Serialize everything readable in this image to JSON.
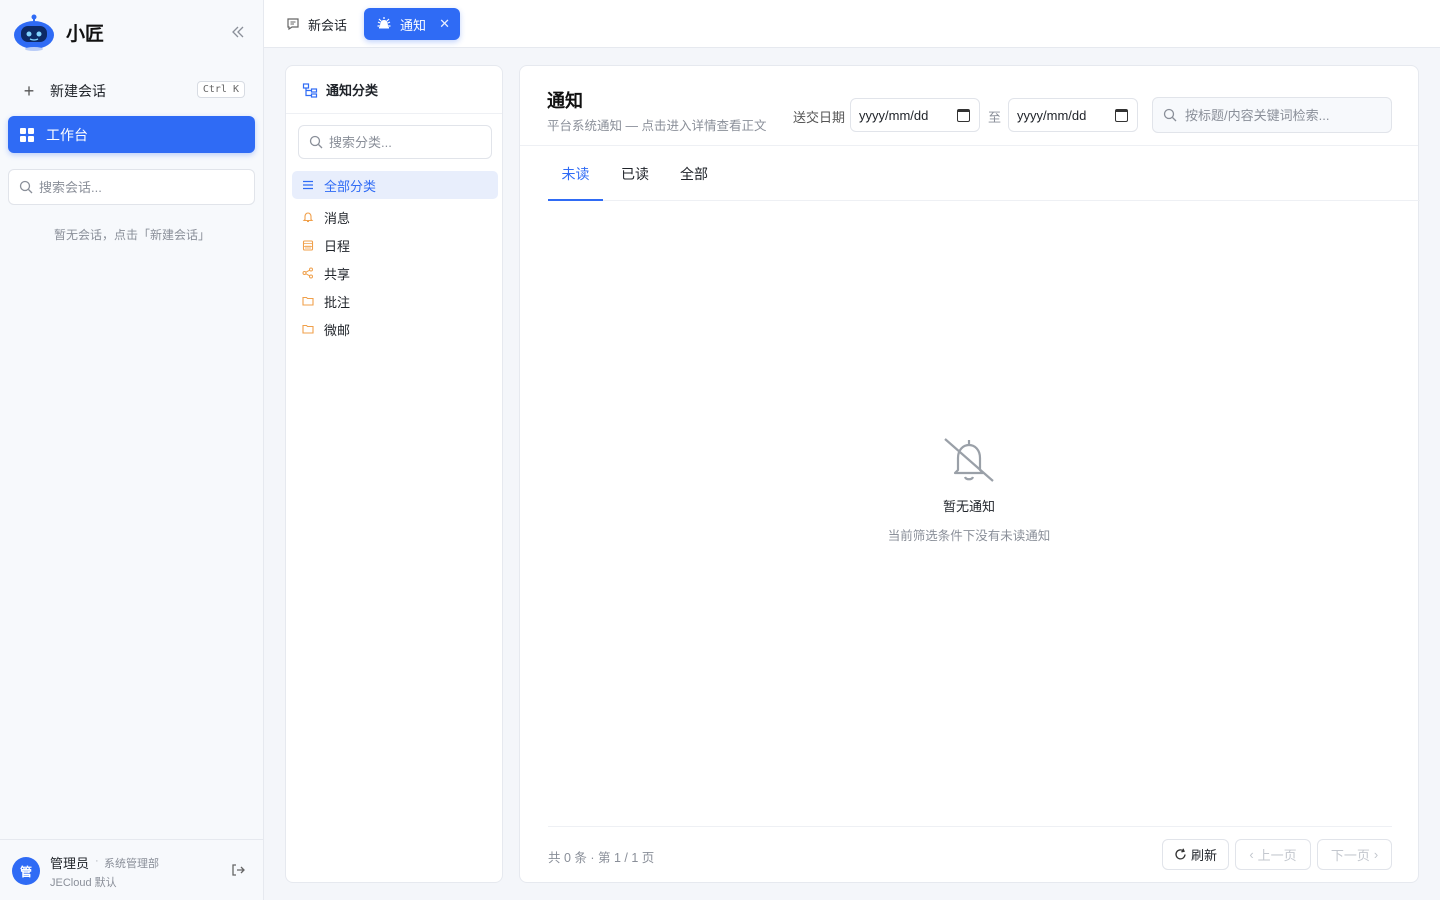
{
  "app": {
    "name": "小匠"
  },
  "sidebar": {
    "new_chat_label": "新建会话",
    "shortcut": "Ctrl K",
    "workbench_label": "工作台",
    "search_placeholder": "搜索会话...",
    "empty_text": "暂无会话，点击「新建会话」"
  },
  "user": {
    "avatar_text": "管",
    "name": "管理员",
    "separator": "·",
    "role": "系统管理部",
    "org": "JECloud 默认"
  },
  "tabs": [
    {
      "label": "新会话",
      "active": false
    },
    {
      "label": "通知",
      "active": true
    }
  ],
  "categories": {
    "title": "通知分类",
    "search_placeholder": "搜索分类...",
    "items": [
      {
        "label": "全部分类",
        "icon": "list-icon",
        "active": true
      },
      {
        "label": "消息",
        "icon": "bell-icon",
        "active": false
      },
      {
        "label": "日程",
        "icon": "calendar-icon",
        "active": false
      },
      {
        "label": "共享",
        "icon": "share-icon",
        "active": false
      },
      {
        "label": "批注",
        "icon": "folder-icon",
        "active": false
      },
      {
        "label": "微邮",
        "icon": "folder-icon",
        "active": false
      }
    ]
  },
  "main": {
    "title": "通知",
    "subtitle": "平台系统通知 — 点击进入详情查看正文",
    "date_label": "送交日期",
    "date_from": "yyyy/mm/dd",
    "date_sep": "至",
    "date_to": "yyyy/mm/dd",
    "search_placeholder": "按标题/内容关键词检索...",
    "filter_tabs": [
      {
        "label": "未读",
        "active": true
      },
      {
        "label": "已读",
        "active": false
      },
      {
        "label": "全部",
        "active": false
      }
    ],
    "empty_title": "暂无通知",
    "empty_sub": "当前筛选条件下没有未读通知",
    "footer": {
      "count_text": "共 0 条 · 第 1 / 1 页",
      "refresh": "刷新",
      "prev": "上一页",
      "next": "下一页"
    }
  },
  "colors": {
    "accent": "#2f6bf5",
    "category_icon": "#f0a04b"
  }
}
